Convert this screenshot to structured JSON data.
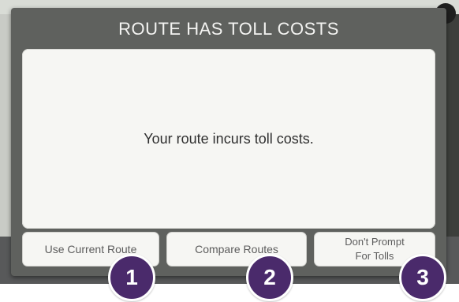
{
  "dialog": {
    "title": "ROUTE HAS TOLL COSTS",
    "message": "Your route incurs toll costs."
  },
  "buttons": {
    "use_current_route": "Use Current Route",
    "compare_routes": "Compare Routes",
    "dont_prompt_line1": "Don't Prompt",
    "dont_prompt_line2": "For Tolls"
  },
  "callouts": {
    "one": "1",
    "two": "2",
    "three": "3"
  },
  "colors": {
    "dialog_frame": "#5f615e",
    "dialog_surface": "#f6f6f3",
    "callout_badge": "#4a2a6b"
  }
}
